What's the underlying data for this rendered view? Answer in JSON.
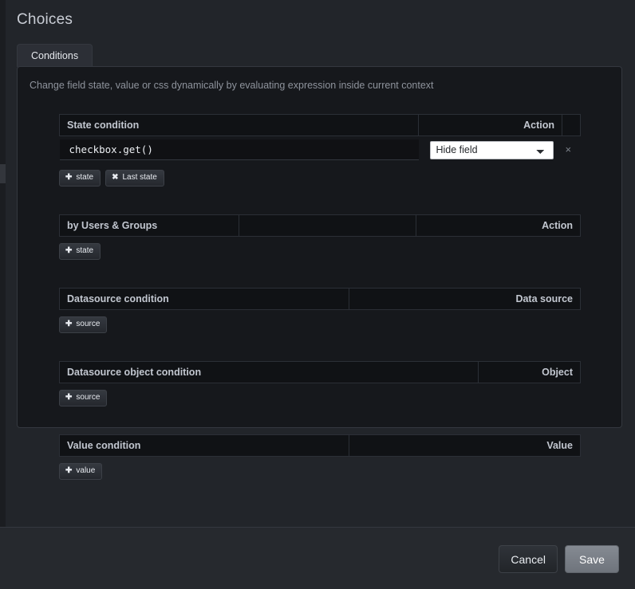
{
  "modal": {
    "title": "Choices",
    "tabs": [
      {
        "label": "Conditions",
        "active": true
      }
    ],
    "description": "Change field state, value or css dynamically by evaluating expression inside current context"
  },
  "sections": [
    {
      "key": "state_condition",
      "headers": [
        "State condition",
        "",
        "Action",
        ""
      ],
      "rows": [
        {
          "expression": "checkbox.get()",
          "action_selected": "Hide field",
          "action_options": [
            "Hide field"
          ],
          "delete_label": "×"
        }
      ],
      "buttons": [
        {
          "icon": "plus-icon",
          "glyph": "✚",
          "label": "state"
        },
        {
          "icon": "cross-icon",
          "glyph": "✖",
          "label": "Last state"
        }
      ]
    },
    {
      "key": "users_groups_condition",
      "headers": [
        "by Users & Groups",
        "",
        "Action"
      ],
      "rows": [],
      "buttons": [
        {
          "icon": "plus-icon",
          "glyph": "✚",
          "label": "state"
        }
      ]
    },
    {
      "key": "datasource_condition",
      "headers": [
        "Datasource condition",
        "Data source"
      ],
      "rows": [],
      "buttons": [
        {
          "icon": "plus-icon",
          "glyph": "✚",
          "label": "source"
        }
      ]
    },
    {
      "key": "datasource_object_condition",
      "headers": [
        "Datasource object condition",
        "Object"
      ],
      "rows": [],
      "buttons": [
        {
          "icon": "plus-icon",
          "glyph": "✚",
          "label": "source"
        }
      ]
    },
    {
      "key": "value_condition",
      "headers": [
        "Value condition",
        "Value"
      ],
      "rows": [],
      "buttons": [
        {
          "icon": "plus-icon",
          "glyph": "✚",
          "label": "value"
        }
      ]
    }
  ],
  "footer": {
    "cancel_label": "Cancel",
    "save_label": "Save"
  },
  "colors": {
    "modal_bg": "#22252a",
    "panel_bg": "#16181c",
    "header_bg": "#101215",
    "border": "#34383f",
    "text": "#c8ccd4",
    "muted_text": "#8e939c",
    "save_bg": "#7a7f87"
  }
}
